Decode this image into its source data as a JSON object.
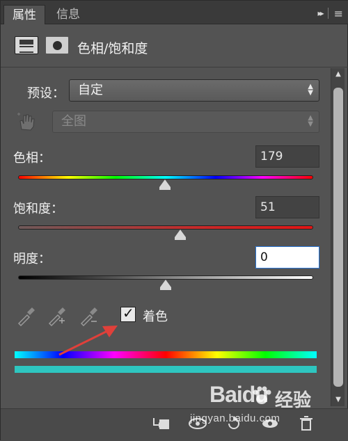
{
  "tabs": [
    {
      "label": "属性",
      "active": true
    },
    {
      "label": "信息",
      "active": false
    }
  ],
  "tab_controls": {
    "collapse": "▸▸",
    "menu": "≡"
  },
  "header": {
    "title": "色相/饱和度"
  },
  "preset": {
    "label": "预设：",
    "value": "自定"
  },
  "channel": {
    "value": "全图"
  },
  "hue": {
    "label": "色相：",
    "value": "179",
    "position_fraction": 0.497
  },
  "saturation": {
    "label": "饱和度：",
    "value": "51",
    "position_fraction": 0.55
  },
  "lightness": {
    "label": "明度：",
    "value": "0",
    "position_fraction": 0.5
  },
  "colorize": {
    "label": "着色",
    "checked": true
  },
  "watermark": {
    "brand": "Baidu",
    "brand_cn": "经验",
    "url": "jingyan.baidu.com"
  },
  "colors": {
    "panel_bg": "#535353",
    "annotation_arrow": "#e0403a",
    "output_strip": "#2ec6c0"
  },
  "icons": [
    "adjustment-layer-icon",
    "layer-mask-icon",
    "targeted-adjust-hand-icon",
    "eyedropper-icon",
    "eyedropper-plus-icon",
    "eyedropper-minus-icon",
    "clip-to-layer-icon",
    "view-previous-icon",
    "reset-icon",
    "visibility-eye-icon",
    "delete-icon"
  ]
}
